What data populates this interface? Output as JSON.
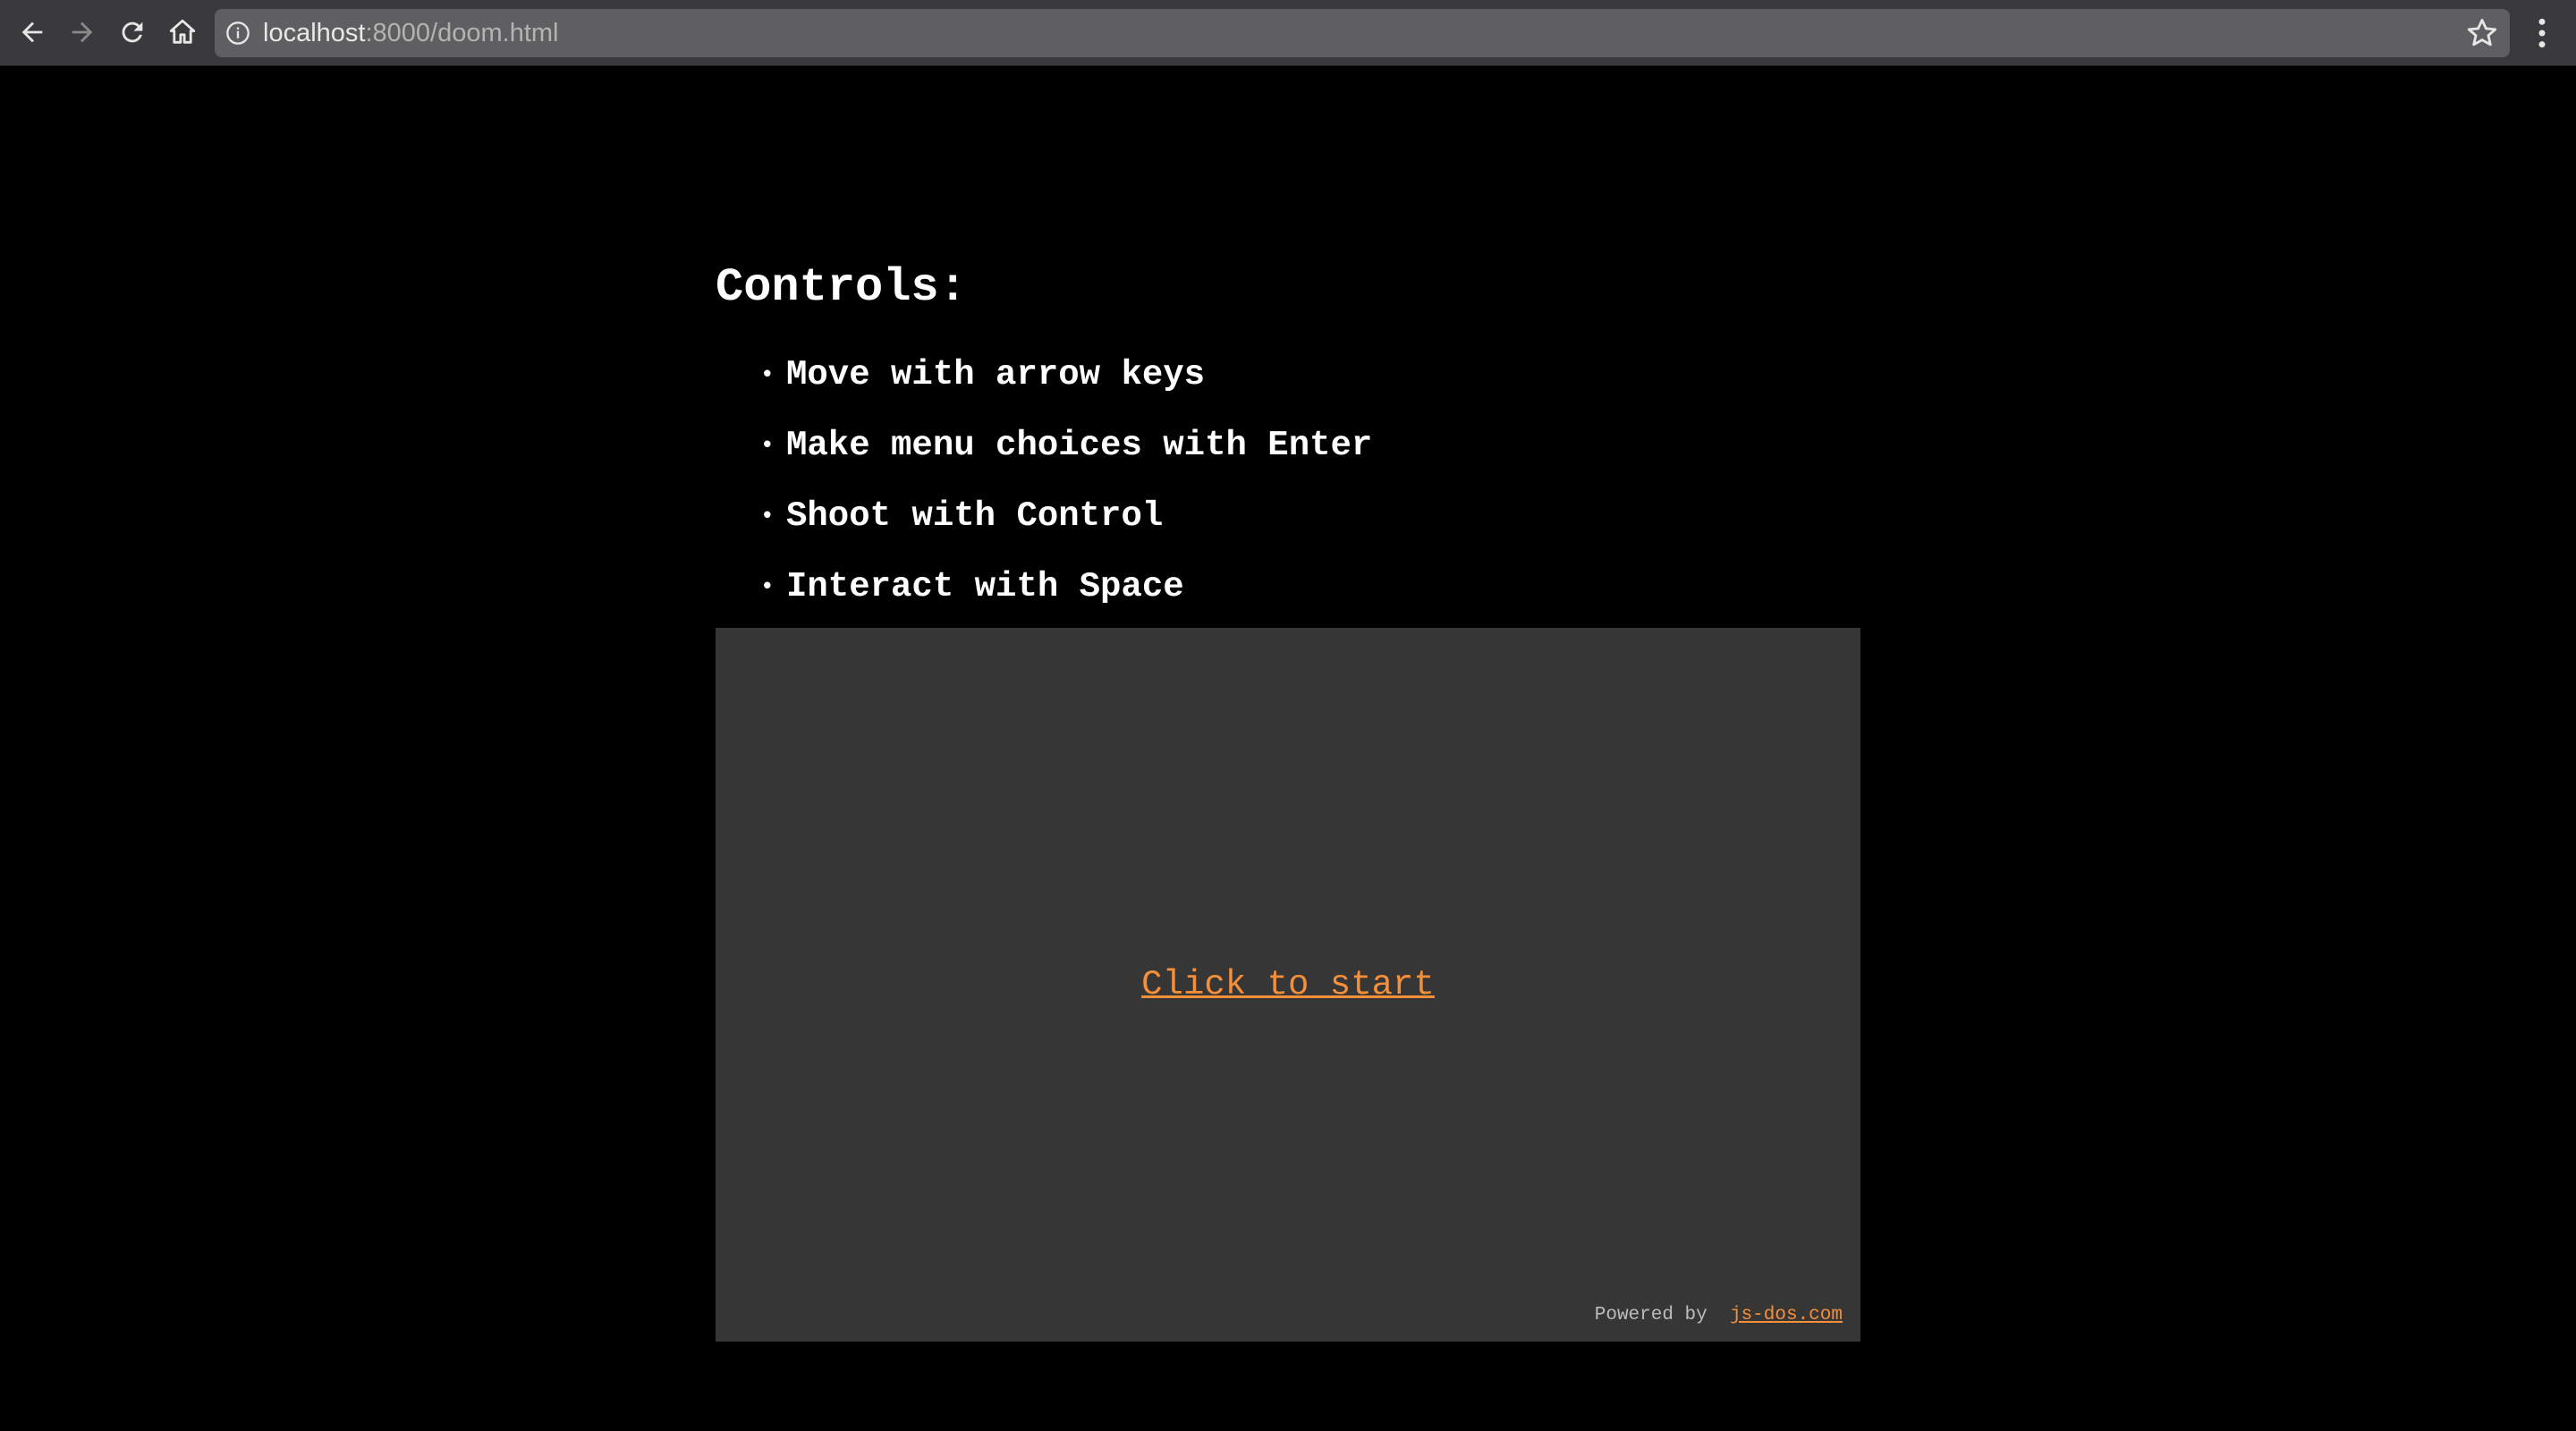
{
  "browser": {
    "url_host": "localhost",
    "url_rest": ":8000/doom.html",
    "icons": {
      "back": "back-arrow-icon",
      "forward": "forward-arrow-icon",
      "reload": "reload-icon",
      "home": "home-icon",
      "info": "info-icon",
      "bookmark": "star-icon",
      "menu": "kebab-menu-icon"
    }
  },
  "content": {
    "heading": "Controls:",
    "controls": [
      "Move with arrow keys",
      "Make menu choices with Enter",
      "Shoot with Control",
      "Interact with Space"
    ],
    "start_label": "Click to start",
    "powered_by_label": "Powered by ",
    "powered_by_link": "js-dos.com"
  },
  "colors": {
    "background": "#000000",
    "panel": "#363636",
    "accent": "#f58f3a",
    "text": "#ffffff"
  }
}
